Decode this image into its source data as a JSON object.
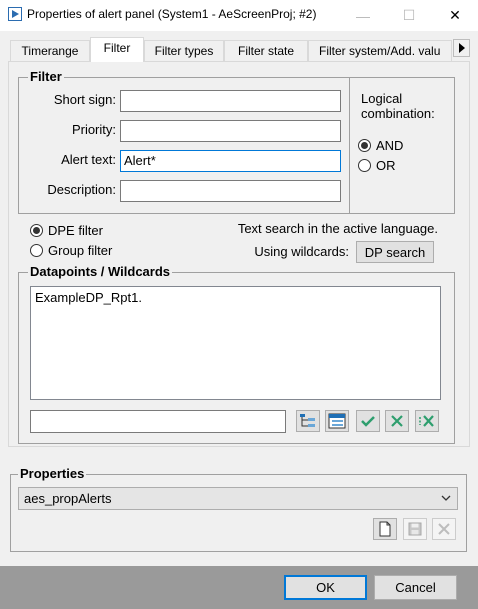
{
  "window": {
    "title": "Properties of alert panel (System1 - AeScreenProj; #2)",
    "minimize_glyph": "—",
    "maximize_glyph": "☐",
    "close_glyph": "✕"
  },
  "tabs": [
    {
      "label": "Timerange",
      "active": false
    },
    {
      "label": "Filter",
      "active": true
    },
    {
      "label": "Filter types",
      "active": false
    },
    {
      "label": "Filter state",
      "active": false
    },
    {
      "label": "Filter system/Add. valu",
      "active": false
    }
  ],
  "filter": {
    "group_title": "Filter",
    "short_sign_label": "Short sign:",
    "short_sign_value": "",
    "priority_label": "Priority:",
    "priority_value": "",
    "alert_text_label": "Alert text:",
    "alert_text_value": "Alert*",
    "description_label": "Description:",
    "description_value": "",
    "logical_combination_label_1": "Logical",
    "logical_combination_label_2": "combination:",
    "and_label": "AND",
    "or_label": "OR",
    "and_selected": true
  },
  "dpe": {
    "dpe_filter_label": "DPE filter",
    "group_filter_label": "Group filter",
    "dpe_selected": true,
    "text_search_note": "Text search in the active language.",
    "using_wildcards_label": "Using wildcards:",
    "dp_search_button": "DP search"
  },
  "datapoints": {
    "group_title": "Datapoints / Wildcards",
    "items": [
      "ExampleDP_Rpt1."
    ],
    "entry_value": ""
  },
  "properties": {
    "group_title": "Properties",
    "selected": "aes_propAlerts"
  },
  "buttons": {
    "ok": "OK",
    "cancel": "Cancel"
  },
  "colors": {
    "accent": "#0078d7",
    "check_green": "#2e9e6e",
    "footer_bg": "#9a9a9a"
  }
}
